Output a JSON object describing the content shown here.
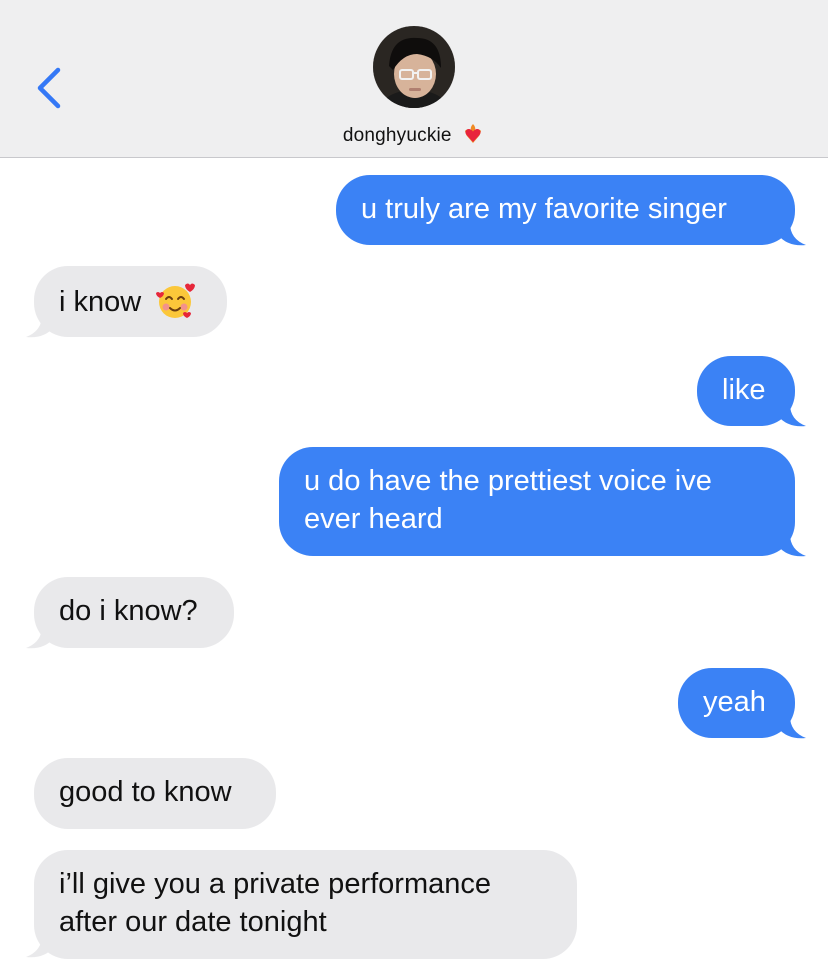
{
  "header": {
    "contact_name": "donghyuckie",
    "avatar_icon": "avatar-photo",
    "back_icon": "chevron-left-icon",
    "name_emoji_icon": "heart-on-fire-icon"
  },
  "colors": {
    "sent": "#3b82f5",
    "received": "#e9e9eb",
    "header_bg": "#efeff0",
    "accent": "#3478f6"
  },
  "messages": [
    {
      "from": "me",
      "text": "u truly are my favorite singer"
    },
    {
      "from": "them",
      "text": "i know",
      "emoji": "smiling-face-with-hearts-icon"
    },
    {
      "from": "me",
      "text": "like"
    },
    {
      "from": "me",
      "lines": [
        "u do have the prettiest voice ive",
        "ever heard"
      ]
    },
    {
      "from": "them",
      "text": "do i know?"
    },
    {
      "from": "me",
      "text": "yeah"
    },
    {
      "from": "them",
      "text": "good to know"
    },
    {
      "from": "them",
      "lines": [
        "i’ll give you a private performance",
        "after our date tonight"
      ]
    }
  ]
}
